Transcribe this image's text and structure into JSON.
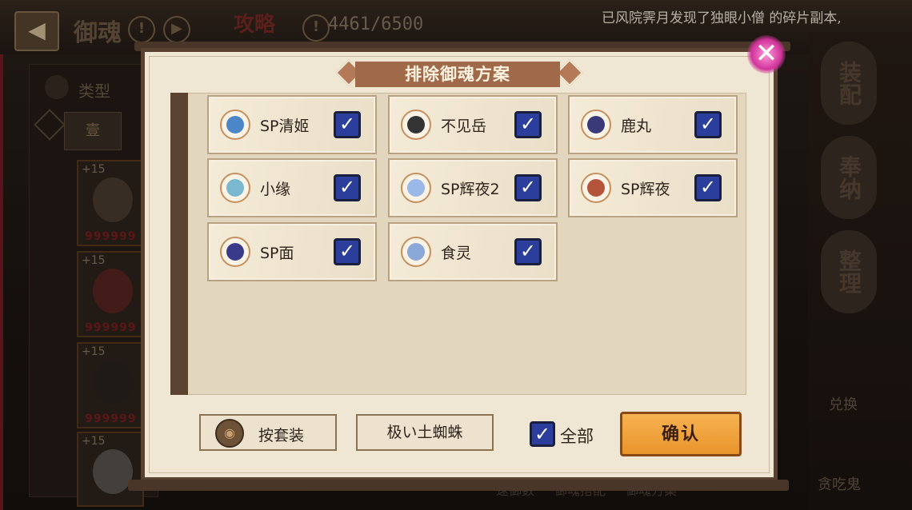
{
  "background": {
    "top_title": "御魂",
    "strategy": "攻略",
    "counter": "4461/6500",
    "marquee": "已风院霁月发现了独眼小僧 的碎片副本,",
    "type_label": "类型",
    "slot_tab": "壹",
    "characters": [
      {
        "level": "+15",
        "count": "999999"
      },
      {
        "level": "+15",
        "count": "999999"
      },
      {
        "level": "+15",
        "count": "999999"
      },
      {
        "level": "+15",
        "count": ""
      }
    ],
    "side_buttons": [
      "装配",
      "奉纳",
      "整理"
    ],
    "side_small": [
      "兑换",
      "贪吃鬼"
    ],
    "bottom_tabs": "速御数  御魂搭配  御魂方案"
  },
  "modal": {
    "title": "排除御魂方案",
    "close_icon": "close-icon",
    "items": [
      {
        "name": "SP清姬",
        "checked": true,
        "color": "#4a86c8"
      },
      {
        "name": "不见岳",
        "checked": true,
        "color": "#333333"
      },
      {
        "name": "鹿丸",
        "checked": true,
        "color": "#3a3a7a"
      },
      {
        "name": "小缘",
        "checked": true,
        "color": "#7ab8d0"
      },
      {
        "name": "SP辉夜2",
        "checked": true,
        "color": "#9ab8e8"
      },
      {
        "name": "SP辉夜",
        "checked": true,
        "color": "#b4543a"
      },
      {
        "name": "SP面",
        "checked": true,
        "color": "#3a3a8a"
      },
      {
        "name": "食灵",
        "checked": true,
        "color": "#8aa8d8"
      }
    ],
    "set_button": "按套装",
    "filter_button": "极い土蜘蛛",
    "all_label": "全部",
    "all_checked": true,
    "confirm_button": "确认"
  }
}
